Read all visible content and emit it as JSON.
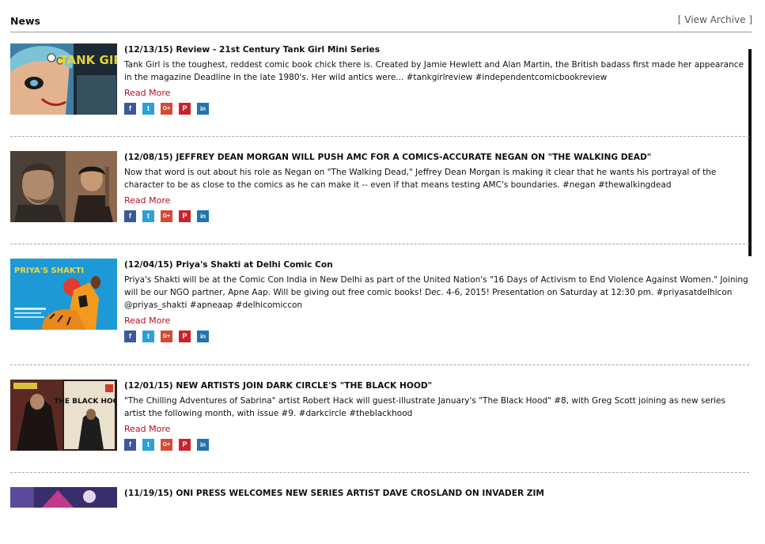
{
  "header": {
    "title": "News",
    "archive_open": "[",
    "archive_label": "View Archive",
    "archive_close": "]"
  },
  "news": {
    "read_more": "Read More",
    "social_icons": [
      "facebook-icon",
      "twitter-icon",
      "google-plus-icon",
      "pinterest-icon",
      "linkedin-icon"
    ],
    "social_glyphs": {
      "facebook": "f",
      "twitter": "t",
      "google_plus": "G+",
      "pinterest": "P",
      "linkedin": "in"
    },
    "social_colors": {
      "facebook": "#3b5998",
      "twitter": "#2d9fd9",
      "google_plus": "#d34a36",
      "pinterest": "#c8232c",
      "linkedin": "#1f74ad"
    },
    "link_color": "#b3121c",
    "items": [
      {
        "title": "(12/13/15) Review - 21st Century Tank Girl Mini Series",
        "body": "Tank Girl is the toughest, reddest comic book chick there is. Created by Jamie Hewlett and Alan Martin, the British badass first made her appearance in the magazine Deadline in the late 1980's. Her wild antics were... #tankgirlreview #independentcomicbookreview",
        "thumb_text": "TANK GIRL"
      },
      {
        "title": "(12/08/15) JEFFREY DEAN MORGAN WILL PUSH AMC FOR A COMICS-ACCURATE NEGAN ON \"THE WALKING DEAD\"",
        "body": "Now that word is out about his role as Negan on \"The Walking Dead,\" Jeffrey Dean Morgan is making it clear that he wants his portrayal of the character to be as close to the comics as he can make it -- even if that means testing AMC's boundaries. #negan #thewalkingdead",
        "thumb_text": ""
      },
      {
        "title": "(12/04/15) Priya's Shakti at Delhi Comic Con",
        "body": "Priya's Shakti will be at the Comic Con India in New Delhi as part of the United Nation's \"16 Days of Activism to End Violence Against Women.\" Joining will be our NGO partner, Apne Aap. Will be giving out free comic books! Dec. 4-6, 2015! Presentation on Saturday at 12:30 pm. #priyasatdelhicon @priyas_shakti #apneaap #delhicomiccon",
        "thumb_text": "PRIYA'S SHAKTI"
      },
      {
        "title": "(12/01/15) NEW ARTISTS JOIN DARK CIRCLE'S \"THE BLACK HOOD\"",
        "body": "\"The Chilling Adventures of Sabrina\" artist Robert Hack will guest-illustrate January's \"The Black Hood\" #8, with Greg Scott joining as new series artist the following month, with issue #9. #darkcircle #theblackhood",
        "thumb_text": "THE BLACK HOOD"
      },
      {
        "title": "(11/19/15) ONI PRESS WELCOMES NEW SERIES ARTIST DAVE CROSLAND ON INVADER ZIM",
        "body": "",
        "thumb_text": ""
      }
    ]
  }
}
